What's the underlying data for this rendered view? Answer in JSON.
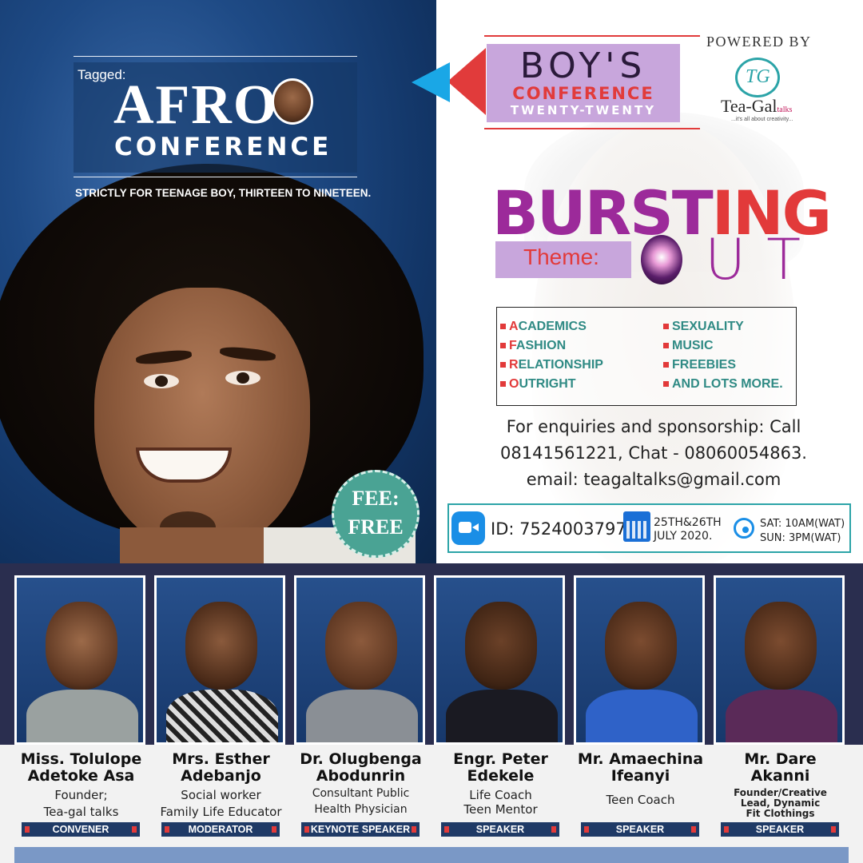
{
  "header": {
    "tagged": "Tagged:",
    "afro": "AFRO",
    "conference": "CONFERENCE",
    "strictly": "STRICTLY FOR TEENAGE BOY, THIRTEEN TO NINETEEN."
  },
  "banner": {
    "boys": "BOY'S",
    "conference": "CONFERENCE",
    "twenty": "TWENTY-TWENTY"
  },
  "sponsor": {
    "powered_by": "POWERED BY",
    "name": "Tea-Gal",
    "suffix": "talks",
    "tagline": "...it's all about creativity..."
  },
  "theme": {
    "word1": "BURST",
    "word2": "ING",
    "label": "Theme:",
    "out": "UT"
  },
  "topics": {
    "left": [
      {
        "first": "A",
        "rest": "CADEMICS"
      },
      {
        "first": "F",
        "rest": "ASHION"
      },
      {
        "first": "R",
        "rest": "ELATIONSHIP"
      },
      {
        "first": "O",
        "rest": "UTRIGHT"
      }
    ],
    "right": [
      "SEXUALITY",
      "MUSIC",
      "FREEBIES",
      "AND LOTS MORE."
    ]
  },
  "contact": {
    "line1": "For enquiries and sponsorship: Call",
    "line2": "08141561221, Chat - 08060054863.",
    "line3": "email: teagaltalks@gmail.com"
  },
  "meeting": {
    "id": "ID: 7524003797",
    "date1": "25TH&26TH",
    "date2": "JULY 2020.",
    "time1": "SAT: 10AM(WAT)",
    "time2": "SUN: 3PM(WAT)"
  },
  "fee": {
    "line1": "FEE:",
    "line2": "FREE"
  },
  "speakers": [
    {
      "name1": "Miss. Tolulope",
      "name2": "Adetoke Asa",
      "desc1": "Founder;",
      "desc2": "Tea-gal talks",
      "desc3": "",
      "role": "CONVENER"
    },
    {
      "name1": "Mrs. Esther",
      "name2": "Adebanjo",
      "desc1": "Social worker",
      "desc2": "Family Life Educator",
      "desc3": "",
      "role": "MODERATOR"
    },
    {
      "name1": "Dr. Olugbenga",
      "name2": "Abodunrin",
      "desc1": "Consultant Public",
      "desc2": "Health Physician",
      "desc3": "",
      "role": "KEYNOTE SPEAKER"
    },
    {
      "name1": "Engr. Peter",
      "name2": "Edekele",
      "desc1": "Life Coach",
      "desc2": "Teen Mentor",
      "desc3": "",
      "role": "SPEAKER"
    },
    {
      "name1": "Mr. Amaechina",
      "name2": "Ifeanyi",
      "desc1": "Teen Coach",
      "desc2": "",
      "desc3": "",
      "role": "SPEAKER"
    },
    {
      "name1": "Mr. Dare",
      "name2": "Akanni",
      "desc1": "Founder/Creative",
      "desc2": "Lead, Dynamic",
      "desc3": "Fit Clothings",
      "role": "SPEAKER"
    }
  ],
  "colors": {
    "purple": "#9c2a9a",
    "red": "#e23a3a",
    "teal": "#2f8a84",
    "lavender": "#c8a6dc",
    "navy": "#1f3a66"
  }
}
